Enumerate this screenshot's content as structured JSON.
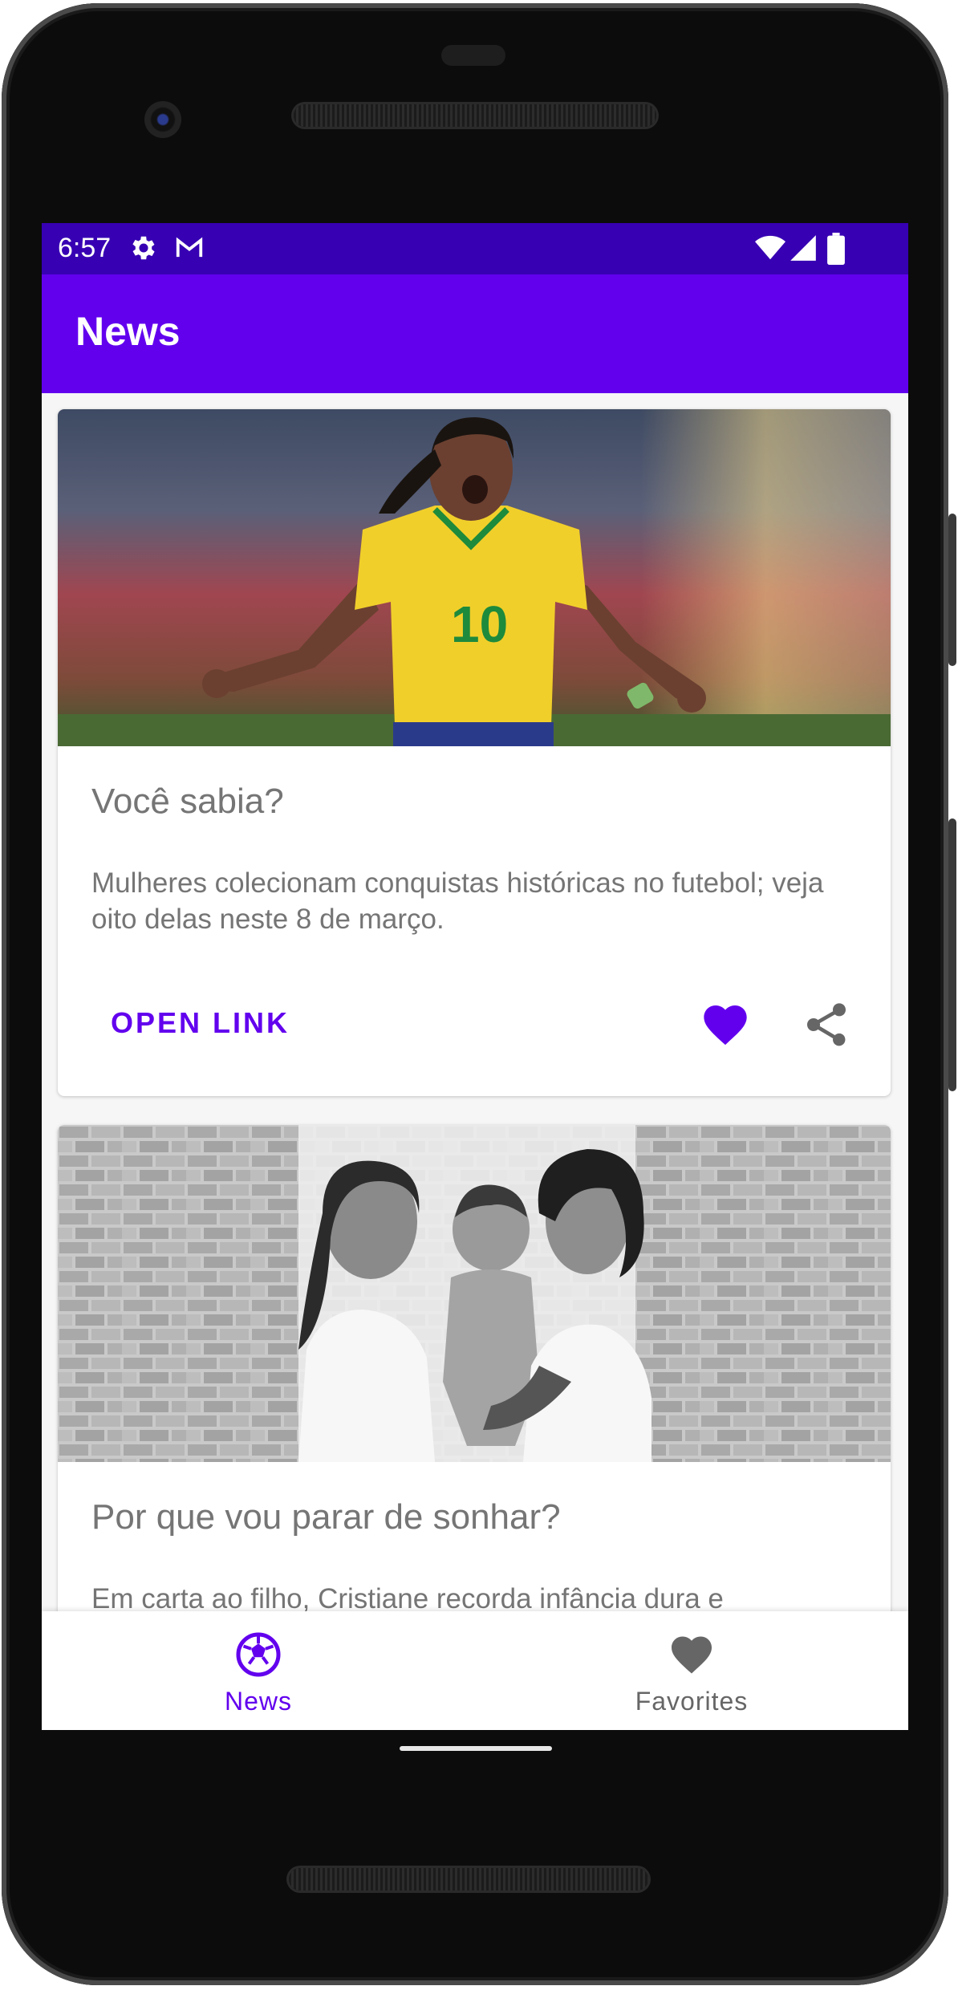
{
  "status_bar": {
    "time": "6:57",
    "icons": [
      "gear-icon",
      "gmail-icon",
      "wifi-icon",
      "signal-icon",
      "battery-icon"
    ]
  },
  "app_bar": {
    "title": "News"
  },
  "cards": [
    {
      "image": "soccer-player-celebrating-photo",
      "title": "Você sabia?",
      "description": "Mulheres colecionam conquistas históricas no futebol; veja oito delas neste 8 de março.",
      "action_label": "OPEN LINK",
      "favorite_icon": "heart-filled-icon",
      "share_icon": "share-icon"
    },
    {
      "image": "family-portrait-bw-photo",
      "title": "Por que vou parar de sonhar?",
      "description": "Em carta ao filho, Cristiane recorda infância dura e"
    }
  ],
  "bottom_nav": {
    "items": [
      {
        "label": "News",
        "icon": "soccer-ball-icon",
        "active": true
      },
      {
        "label": "Favorites",
        "icon": "heart-icon",
        "active": false
      }
    ]
  },
  "colors": {
    "primary": "#6200ee",
    "primary_dark": "#3700b3",
    "text_secondary": "#757575",
    "inactive": "#666666"
  }
}
